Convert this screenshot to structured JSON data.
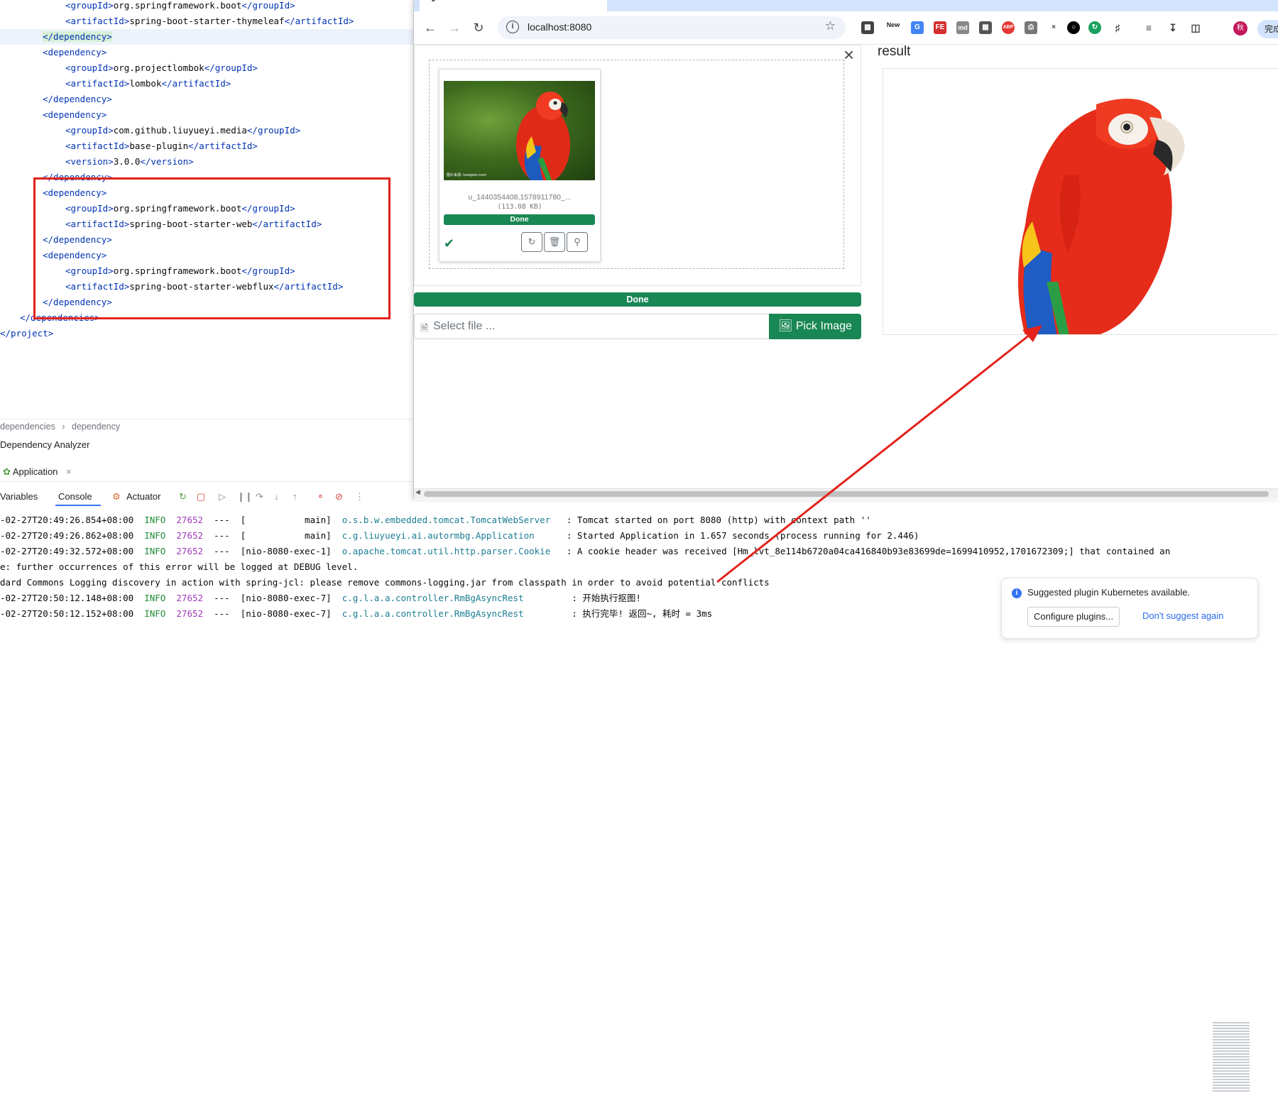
{
  "editor": {
    "lines": [
      {
        "indent": 2,
        "open": "<groupId>",
        "text": "org.springframework.boot",
        "close": "</groupId>"
      },
      {
        "indent": 2,
        "open": "<artifactId>",
        "text": "spring-boot-starter-thymeleaf",
        "close": "</artifactId>"
      },
      {
        "indent": 1,
        "open": "</dependency>",
        "text": "",
        "close": ""
      },
      {
        "indent": 1,
        "open": "<dependency>",
        "text": "",
        "close": ""
      },
      {
        "indent": 2,
        "open": "<groupId>",
        "text": "org.projectlombok",
        "close": "</groupId>"
      },
      {
        "indent": 2,
        "open": "<artifactId>",
        "text": "lombok",
        "close": "</artifactId>"
      },
      {
        "indent": 1,
        "open": "</dependency>",
        "text": "",
        "close": ""
      },
      {
        "indent": 1,
        "open": "<dependency>",
        "text": "",
        "close": ""
      },
      {
        "indent": 2,
        "open": "<groupId>",
        "text": "com.github.liuyueyi.media",
        "close": "</groupId>"
      },
      {
        "indent": 2,
        "open": "<artifactId>",
        "text": "base-plugin",
        "close": "</artifactId>"
      },
      {
        "indent": 2,
        "open": "<version>",
        "text": "3.0.0",
        "close": "</version>"
      },
      {
        "indent": 1,
        "open": "</dependency>",
        "text": "",
        "close": ""
      },
      {
        "indent": 1,
        "open": "<dependency>",
        "text": "",
        "close": ""
      },
      {
        "indent": 2,
        "open": "<groupId>",
        "text": "org.springframework.boot",
        "close": "</groupId>"
      },
      {
        "indent": 2,
        "open": "<artifactId>",
        "text": "spring-boot-starter-web",
        "close": "</artifactId>"
      },
      {
        "indent": 1,
        "open": "</dependency>",
        "text": "",
        "close": ""
      },
      {
        "indent": 1,
        "open": "<dependency>",
        "text": "",
        "close": ""
      },
      {
        "indent": 2,
        "open": "<groupId>",
        "text": "org.springframework.boot",
        "close": "</groupId>"
      },
      {
        "indent": 2,
        "open": "<artifactId>",
        "text": "spring-boot-starter-webflux",
        "close": "</artifactId>"
      },
      {
        "indent": 1,
        "open": "</dependency>",
        "text": "",
        "close": ""
      },
      {
        "indent": 0,
        "open": "</dependencies>",
        "text": "",
        "close": ""
      },
      {
        "indent": -1,
        "open": "</project>",
        "text": "",
        "close": ""
      }
    ],
    "breadcrumbs": [
      "dependencies",
      "dependency"
    ],
    "breadcrumb_separator": "›"
  },
  "ide": {
    "analyzer_label": "Dependency Analyzer",
    "run_tab": "Application",
    "tabs": [
      "Variables",
      "Console",
      "Actuator"
    ],
    "logs": [
      {
        "ts": "-02-27T20:49:26.854+08:00",
        "level": "INFO",
        "pid": "27652",
        "sep": "---",
        "thread": "[           main]",
        "cls": "o.s.b.w.embedded.tomcat.TomcatWebServer ",
        "msg": " : Tomcat started on port 8080 (http) with context path ''"
      },
      {
        "ts": "-02-27T20:49:26.862+08:00",
        "level": "INFO",
        "pid": "27652",
        "sep": "---",
        "thread": "[           main]",
        "cls": "c.g.liuyueyi.ai.autormbg.Application    ",
        "msg": " : Started Application in 1.657 seconds (process running for 2.446)"
      },
      {
        "ts": "-02-27T20:49:32.572+08:00",
        "level": "INFO",
        "pid": "27652",
        "sep": "---",
        "thread": "[nio-8080-exec-1]",
        "cls": "o.apache.tomcat.util.http.parser.Cookie ",
        "msg": " : A cookie header was received [Hm_lvt_8e114b6720a04ca416840b93e83699de=1699410952,1701672309;] that contained an"
      },
      {
        "plain": "e: further occurrences of this error will be logged at DEBUG level."
      },
      {
        "plain": "dard Commons Logging discovery in action with spring-jcl: please remove commons-logging.jar from classpath in order to avoid potential conflicts"
      },
      {
        "ts": "-02-27T20:50:12.148+08:00",
        "level": "INFO",
        "pid": "27652",
        "sep": "---",
        "thread": "[nio-8080-exec-7]",
        "cls": "c.g.l.a.a.controller.RmBgAsyncRest       ",
        "msg": " : 开始执行抠图!"
      },
      {
        "ts": "-02-27T20:50:12.152+08:00",
        "level": "INFO",
        "pid": "27652",
        "sep": "---",
        "thread": "[nio-8080-exec-7]",
        "cls": "c.g.l.a.a.controller.RmBgAsyncRest       ",
        "msg": " : 执行完毕! 返回~, 耗时 = 3ms"
      }
    ]
  },
  "browser": {
    "url": "localhost:8080",
    "profile_initial": "秋",
    "finish_label": "完成",
    "ext_new_label": "New",
    "ext_abp_label": "ABP",
    "ext_md_label": "md",
    "upload": {
      "file_name": "u_1440354408,1578911780_...",
      "file_size": "(113.08 KB)",
      "thumb_status": "Done",
      "overall_status": "Done",
      "placeholder": "Select file ...",
      "pick_label": "Pick Image",
      "thumb_watermark": "图片来源: tooopen.com"
    },
    "result_label": "result"
  },
  "notification": {
    "text": "Suggested plugin Kubernetes available.",
    "configure_label": "Configure plugins...",
    "dismiss_label": "Don't suggest again"
  },
  "colors": {
    "success": "#198754",
    "annotation": "#e3231c",
    "xml_tag": "#0033b3"
  }
}
